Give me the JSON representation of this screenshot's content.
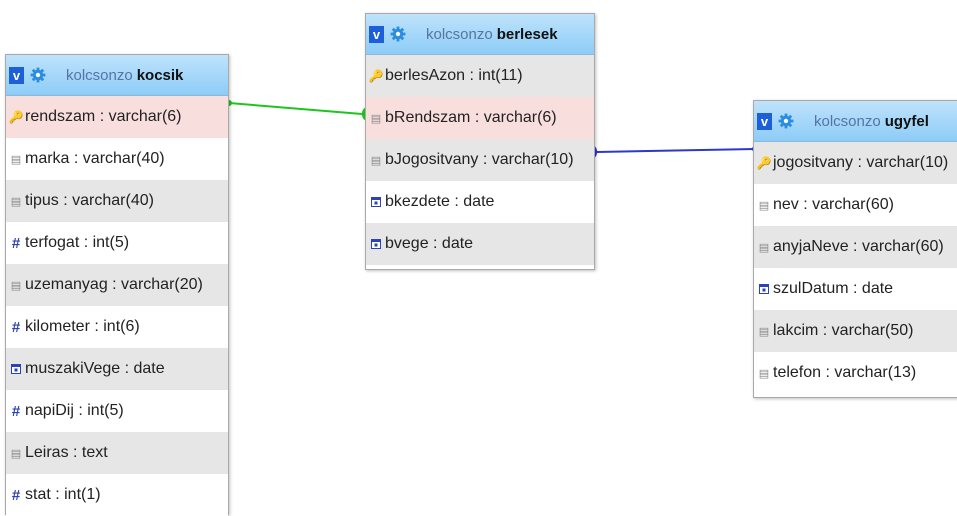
{
  "colors": {
    "header_top": "#bfe3fb",
    "header_bottom": "#8dccf7",
    "database_text": "#5873a3",
    "toggle_bg": "#1d5fd9",
    "gear": "#2a8de0",
    "related_row": "#f9dede",
    "alt_row": "#e6e6e6",
    "link_green": "#1ec51e",
    "link_blue": "#2c38c9"
  },
  "tables": [
    {
      "database": "kolcsonzo",
      "name": "kocsik",
      "toggle": "v",
      "columns": [
        {
          "text": "rendszam : varchar(6)",
          "icon": "key-icon",
          "related": true
        },
        {
          "text": "marka : varchar(40)",
          "icon": "text-type-icon"
        },
        {
          "text": "tipus : varchar(40)",
          "icon": "text-type-icon"
        },
        {
          "text": "terfogat : int(5)",
          "icon": "number-type-icon"
        },
        {
          "text": "uzemanyag : varchar(20)",
          "icon": "text-type-icon"
        },
        {
          "text": "kilometer : int(6)",
          "icon": "number-type-icon"
        },
        {
          "text": "muszakiVege : date",
          "icon": "date-type-icon"
        },
        {
          "text": "napiDij : int(5)",
          "icon": "number-type-icon"
        },
        {
          "text": "Leiras : text",
          "icon": "text-type-icon"
        },
        {
          "text": "stat : int(1)",
          "icon": "number-type-icon"
        }
      ]
    },
    {
      "database": "kolcsonzo",
      "name": "berlesek",
      "toggle": "v",
      "columns": [
        {
          "text": "berlesAzon : int(11)",
          "icon": "key-icon"
        },
        {
          "text": "bRendszam : varchar(6)",
          "icon": "text-type-icon",
          "related": true
        },
        {
          "text": "bJogositvany : varchar(10)",
          "icon": "text-type-icon"
        },
        {
          "text": "bkezdete : date",
          "icon": "date-type-icon"
        },
        {
          "text": "bvege : date",
          "icon": "date-type-icon"
        }
      ]
    },
    {
      "database": "kolcsonzo",
      "name": "ugyfel",
      "toggle": "v",
      "columns": [
        {
          "text": "jogositvany : varchar(10)",
          "icon": "key-icon"
        },
        {
          "text": "nev : varchar(60)",
          "icon": "text-type-icon"
        },
        {
          "text": "anyjaNeve : varchar(60)",
          "icon": "text-type-icon"
        },
        {
          "text": "szulDatum : date",
          "icon": "date-type-icon"
        },
        {
          "text": "lakcim : varchar(50)",
          "icon": "text-type-icon"
        },
        {
          "text": "telefon : varchar(13)",
          "icon": "text-type-icon"
        }
      ]
    }
  ]
}
